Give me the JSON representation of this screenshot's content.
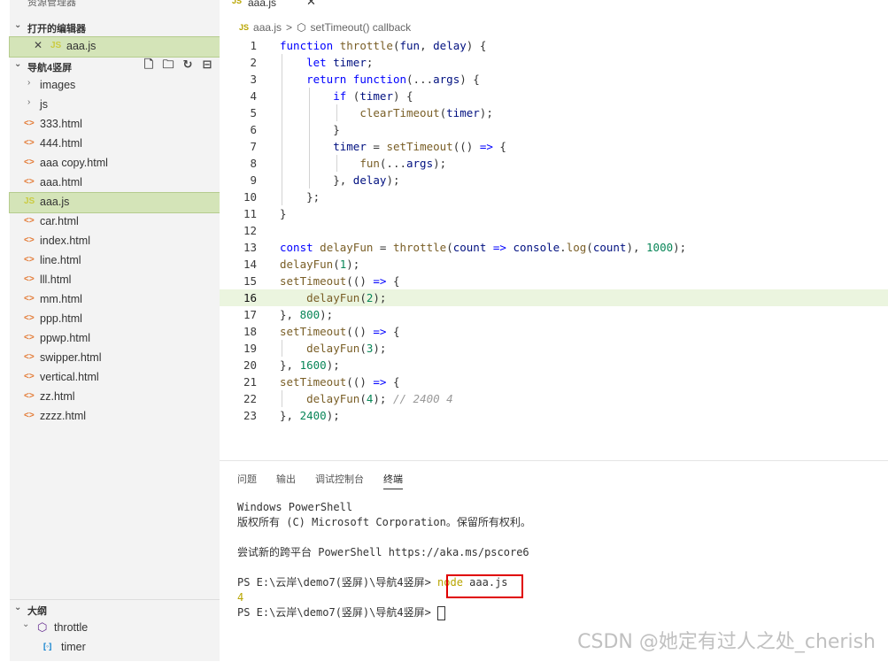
{
  "explorer": {
    "title": "资源管理器",
    "more": "···",
    "open_editors": {
      "label": "打开的编辑器",
      "items": [
        {
          "icon": "JS",
          "name": "aaa.js"
        }
      ]
    },
    "folder": {
      "label": "导航4竖屏",
      "actions": [
        "new-file-icon",
        "new-folder-icon",
        "refresh-icon",
        "collapse-icon"
      ],
      "items": [
        {
          "type": "folder",
          "name": "images"
        },
        {
          "type": "folder",
          "name": "js"
        },
        {
          "type": "html",
          "icon": "<>",
          "name": "333.html"
        },
        {
          "type": "html",
          "icon": "<>",
          "name": "444.html"
        },
        {
          "type": "html",
          "icon": "<>",
          "name": "aaa copy.html"
        },
        {
          "type": "html",
          "icon": "<>",
          "name": "aaa.html"
        },
        {
          "type": "js",
          "icon": "JS",
          "name": "aaa.js"
        },
        {
          "type": "html",
          "icon": "<>",
          "name": "car.html"
        },
        {
          "type": "html",
          "icon": "<>",
          "name": "index.html"
        },
        {
          "type": "html",
          "icon": "<>",
          "name": "line.html"
        },
        {
          "type": "html",
          "icon": "<>",
          "name": "lll.html"
        },
        {
          "type": "html",
          "icon": "<>",
          "name": "mm.html"
        },
        {
          "type": "html",
          "icon": "<>",
          "name": "ppp.html"
        },
        {
          "type": "html",
          "icon": "<>",
          "name": "ppwp.html"
        },
        {
          "type": "html",
          "icon": "<>",
          "name": "swipper.html"
        },
        {
          "type": "html",
          "icon": "<>",
          "name": "vertical.html"
        },
        {
          "type": "html",
          "icon": "<>",
          "name": "zz.html"
        },
        {
          "type": "html",
          "icon": "<>",
          "name": "zzzz.html"
        }
      ]
    },
    "outline": {
      "label": "大纲",
      "items": [
        {
          "name": "throttle"
        },
        {
          "name": "timer"
        }
      ]
    }
  },
  "editor": {
    "tab": {
      "icon": "JS",
      "name": "aaa.js",
      "close": "✕"
    },
    "breadcrumb": {
      "file": "aaa.js",
      "separator": ">",
      "symbol": "setTimeout() callback"
    },
    "active_line": 16
  },
  "panel": {
    "tabs": [
      "问题",
      "输出",
      "调试控制台",
      "终端"
    ],
    "active_tab": "终端",
    "terminal": {
      "l1": "Windows PowerShell",
      "l2": "版权所有 (C) Microsoft Corporation。保留所有权利。",
      "l3": "尝试新的跨平台 PowerShell https://aka.ms/pscore6",
      "prompt": "PS E:\\云岸\\demo7(竖屏)\\导航4竖屏> ",
      "cmd_node": "node",
      "cmd_arg": " aaa.js",
      "output": "4"
    }
  },
  "watermark": "CSDN @她定有过人之处_cherish",
  "colors": {
    "highlight_box": "#e00000",
    "selected_row": "#d4e4b8"
  }
}
